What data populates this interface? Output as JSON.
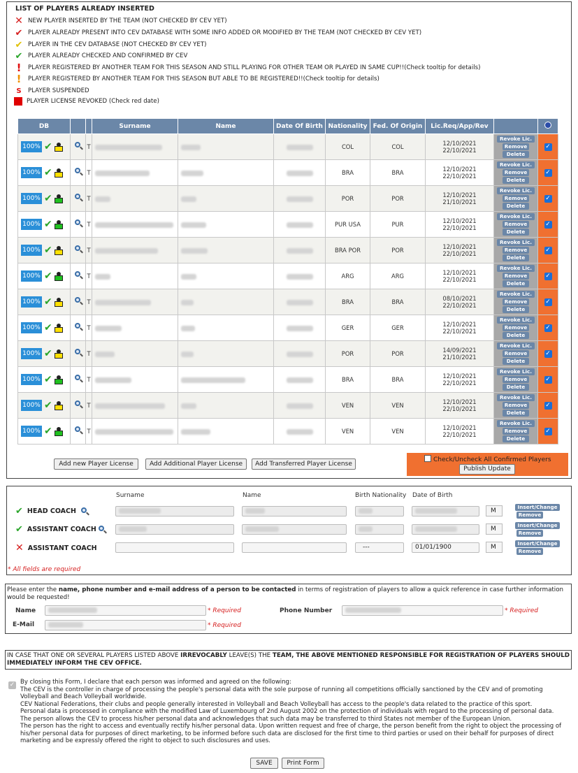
{
  "legend": {
    "title": "LIST OF PLAYERS ALREADY INSERTED",
    "items": [
      {
        "icon": "x-red",
        "text": "NEW PLAYER INSERTED BY THE TEAM (NOT CHECKED BY CEV YET)"
      },
      {
        "icon": "check-red",
        "text": "PLAYER ALREADY PRESENT INTO CEV DATABASE WITH SOME INFO ADDED OR MODIFIED BY THE TEAM (NOT CHECKED BY CEV YET)"
      },
      {
        "icon": "check-yellow",
        "text": "PLAYER IN THE CEV DATABASE (NOT CHECKED BY CEV YET)"
      },
      {
        "icon": "check-green",
        "text": "PLAYER ALREADY CHECKED AND CONFIRMED BY CEV"
      },
      {
        "icon": "exclamation-red",
        "text": "PLAYER REGISTERED BY ANOTHER TEAM FOR THIS SEASON AND STILL PLAYING FOR OTHER TEAM OR PLAYED IN SAME CUP!!(Check tooltip for details)"
      },
      {
        "icon": "exclamation-orange",
        "text": "PLAYER REGISTERED BY ANOTHER TEAM FOR THIS SEASON BUT ABLE TO BE REGISTERED!!(Check tooltip for details)"
      },
      {
        "icon": "s-red",
        "text": "PLAYER SUSPENDED"
      },
      {
        "icon": "square-red",
        "text": "PLAYER LICENSE REVOKED (Check red date)"
      }
    ]
  },
  "table": {
    "headers": {
      "db": "DB",
      "surname": "Surname",
      "name": "Name",
      "dob": "Date Of Birth",
      "nationality": "Nationality",
      "origin": "Fed. Of Origin",
      "lic": "Lic.Req/App/Rev"
    },
    "pct_label": "100%",
    "t_label": "T",
    "revoke_label": "Revoke Lic.",
    "remove_label": "Remove",
    "delete_label": "Delete",
    "rows": [
      {
        "person": "yellow",
        "nationality": "COL",
        "origin": "COL",
        "lic1": "12/10/2021",
        "lic2": "22/10/2021"
      },
      {
        "person": "yellow",
        "nationality": "BRA",
        "origin": "BRA",
        "lic1": "12/10/2021",
        "lic2": "22/10/2021"
      },
      {
        "person": "green",
        "nationality": "POR",
        "origin": "POR",
        "lic1": "12/10/2021",
        "lic2": "21/10/2021"
      },
      {
        "person": "green",
        "nationality": "PUR USA",
        "origin": "PUR",
        "lic1": "12/10/2021",
        "lic2": "22/10/2021"
      },
      {
        "person": "yellow",
        "nationality": "BRA POR",
        "origin": "POR",
        "lic1": "12/10/2021",
        "lic2": "22/10/2021"
      },
      {
        "person": "green",
        "nationality": "ARG",
        "origin": "ARG",
        "lic1": "12/10/2021",
        "lic2": "22/10/2021"
      },
      {
        "person": "yellow",
        "nationality": "BRA",
        "origin": "BRA",
        "lic1": "08/10/2021",
        "lic2": "22/10/2021"
      },
      {
        "person": "yellow",
        "nationality": "GER",
        "origin": "GER",
        "lic1": "12/10/2021",
        "lic2": "22/10/2021"
      },
      {
        "person": "yellow",
        "nationality": "POR",
        "origin": "POR",
        "lic1": "14/09/2021",
        "lic2": "21/10/2021"
      },
      {
        "person": "green",
        "nationality": "BRA",
        "origin": "BRA",
        "lic1": "12/10/2021",
        "lic2": "22/10/2021"
      },
      {
        "person": "yellow",
        "nationality": "VEN",
        "origin": "VEN",
        "lic1": "12/10/2021",
        "lic2": "22/10/2021"
      },
      {
        "person": "green",
        "nationality": "VEN",
        "origin": "VEN",
        "lic1": "12/10/2021",
        "lic2": "22/10/2021"
      }
    ]
  },
  "actions": {
    "add_new": "Add new Player License",
    "add_additional": "Add Additional Player License",
    "add_transferred": "Add Transferred Player License",
    "check_all": "Check/Uncheck All Confirmed Players",
    "publish": "Publish Update"
  },
  "coaches": {
    "hdr_surname": "Surname",
    "hdr_name": "Name",
    "hdr_birth_nat": "Birth Nationality",
    "hdr_dob": "Date of Birth",
    "head_coach": "HEAD COACH",
    "assistant_coach": "ASSISTANT COACH",
    "m_label": "M",
    "nat_placeholder": "---",
    "dob_default": "01/01/1900",
    "insert_change": "Insert/Change",
    "remove": "Remove",
    "required_note": "* All fields are required"
  },
  "contact": {
    "intro_before": "Please enter the ",
    "intro_bold": "name, phone number and e-mail address of a person to be contacted",
    "intro_after": " in terms of registration of players to allow a quick reference in case further information would be requested!",
    "name_label": "Name",
    "phone_label": "Phone Number",
    "email_label": "E-Mail",
    "required": "* Required"
  },
  "notice": {
    "p1": "IN CASE THAT ONE OR SEVERAL PLAYERS LISTED ABOVE ",
    "b1": "IRREVOCABLY",
    "p2": " LEAVE(S) THE ",
    "b2": "TEAM, THE ABOVE MENTIONED RESPONSIBLE FOR REGISTRATION OF PLAYERS SHOULD IMMEDIATELY INFORM THE CEV OFFICE."
  },
  "consent": {
    "lines": [
      "By closing this Form, I declare that each person was informed and agreed on the following:",
      "The CEV is the controller in charge of processing the people's personal data with the sole purpose of running all competitions officially sanctioned by the CEV and of promoting Volleyball and Beach Volleyball worldwide.",
      "CEV National Federations, their clubs and people generally interested in Volleyball and Beach Volleyball has access to the people's data related to the practice of this sport.",
      "Personal data is processed in compliance with the modified Law of Luxembourg of 2nd August 2002 on the protection of individuals with regard to the processing of personal data.",
      "The person allows the CEV to process his/her personal data and acknowledges that such data may be transferred to third States not member of the European Union.",
      "The person has the right to access and eventually rectify his/her personal data. Upon written request and free of charge, the person benefit from the right to object the processing of his/her personal data for purposes of direct marketing, to be informed before such data are disclosed for the first time to third parties or used on their behalf for purposes of direct marketing and be expressly offered the right to object to such disclosures and uses."
    ],
    "save": "SAVE",
    "print": "Print Form"
  }
}
